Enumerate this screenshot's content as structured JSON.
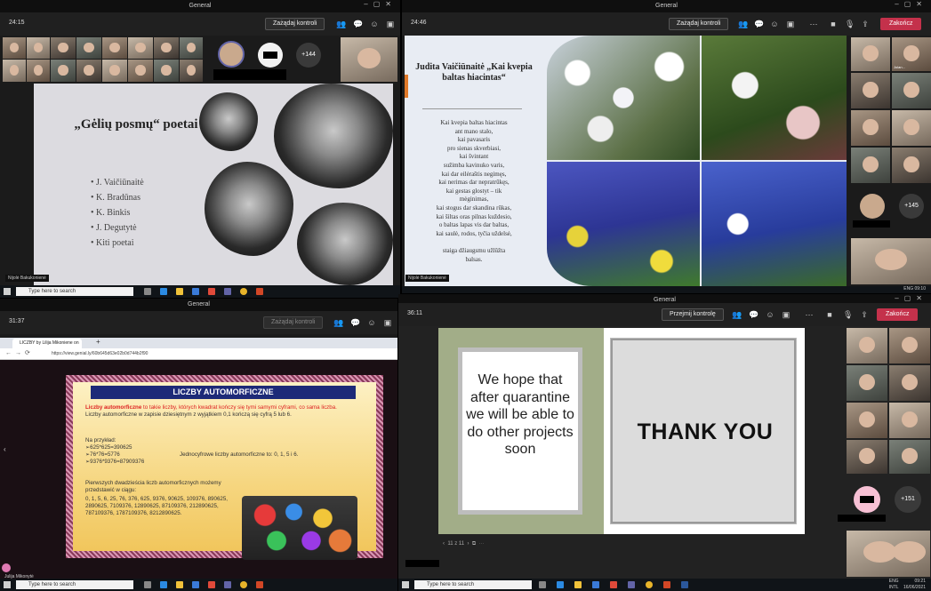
{
  "q1": {
    "window_title": "General",
    "timer": "24:15",
    "control_button": "Zażądaj kontroli",
    "more_count": "+144",
    "slide": {
      "title": "„Gėlių posmų“ poetai",
      "items": [
        "J. Vaičiūnaitė",
        "K. Bradūnas",
        "K. Binkis",
        "J. Degutytė",
        "Kiti poetai"
      ]
    },
    "nameplate": "Nijolė Bakukonienė",
    "taskbar_search": "Type here to search"
  },
  "q2": {
    "window_title": "General",
    "timer": "24:46",
    "control_button": "Zażądaj kontroli",
    "end_button": "Zakończ",
    "more_count": "+145",
    "slide": {
      "title": "Judita Vaičiūnaitė „Kai kvepia baltas hiacintas“",
      "poem": "Kai kvepia baltas hiacintas\nant mano stalo,\nkai pavasaris\npro sienas skverbiasi,\nkai švintant\nsužimba kavinuko varis,\nkai dar eilėraštis negimęs,\nkai nerimas dar nepratrūkęs,\nkai gestas glostyt – tik\nmėginimas,\nkai stogus dar skandina rūkas,\nkai šiltas oras pilnas kuždesio,\no baltas lapas vis dar baltas,\nkai saulė, rodos, tyčia uždelsė,\n\nstaiga džiaugsmu užlūžta\nbalsas."
    },
    "participant_label": "Jolan...",
    "nameplate": "Nijolė Bakukonienė",
    "tray_lang": "ENG",
    "tray_time": "09:10"
  },
  "q3": {
    "window_title": "General",
    "timer": "31:37",
    "control_button": "Zażądaj kontroli",
    "browser_tab": "LICZBY by Lilija Mikoniene on G...",
    "url": "https://view.genial.ly/60b645d63e02b0d744b2f90",
    "slide": {
      "header": "LICZBY AUTOMORFICZNE",
      "intro_red": "Liczby automorficzne",
      "intro_rest": " to takie liczby, których kwadrat kończy się tymi samymi cyframi, co sama liczba.",
      "intro_line2": "Liczby automorficzne w zapisie dziesiętnym z wyjątkiem 0,1 kończą się cyfrą 5 lub 6.",
      "example_label": "Na przykład:",
      "examples": [
        "➢625*625=390625",
        "➢76*76=5776",
        "➢9376*9376=87909376"
      ],
      "single_digit": "Jednocyfrowe liczby automorficzne to: 0, 1, 5 i 6.",
      "first20_label": "Pierwszych dwadzieścia liczb automorficznych możemy przedstawić w ciągu:",
      "sequence": "0, 1, 5, 6, 25, 76, 376, 625, 9376, 90625, 109376, 890625, 2890625, 7109376, 12890625, 87109376, 212890625, 787109376, 1787109376, 8212890625."
    },
    "nameplate": "Julija Mikonytė",
    "taskbar_search": "Type here to search"
  },
  "q4": {
    "window_title": "General",
    "timer": "36:11",
    "control_button": "Przejmij kontrolę",
    "end_button": "Zakończ",
    "slide": {
      "left_text": "We hope that after quarantine we will be able to do other projects soon",
      "right_text": "THANK YOU"
    },
    "pager": "11 z 11",
    "more_count": "+151",
    "taskbar_search": "Type here to search",
    "tray_lang": "ENG\nINTL",
    "tray_time": "09:21",
    "tray_date": "16/06/2021"
  }
}
